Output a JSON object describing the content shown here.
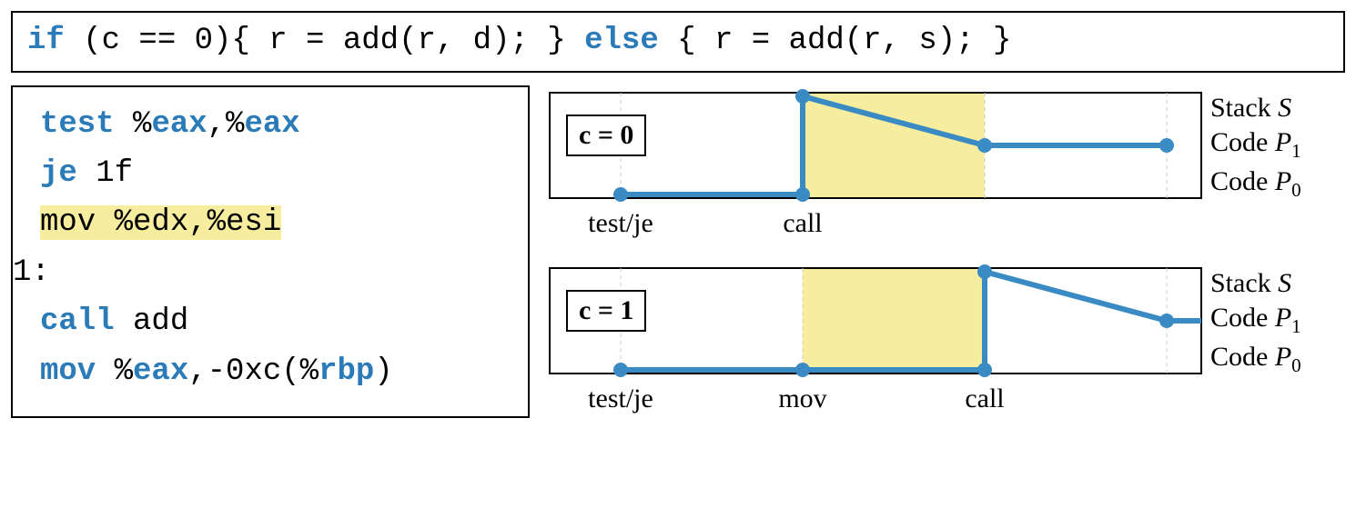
{
  "source_code": {
    "kw_if": "if",
    "cond": " (c == 0){ r = add(r, d); } ",
    "kw_else": "else",
    "else_body": " { r = add(r, s); }"
  },
  "asm": {
    "l1_op": "test",
    "l1_args_a": " %",
    "l1_reg1": "eax",
    "l1_comma": ",%",
    "l1_reg2": "eax",
    "l2_op": "je",
    "l2_arg": " 1f",
    "l3": "mov %edx,%esi",
    "label": "1:",
    "l5_op": "call",
    "l5_arg": " add",
    "l6_op": "mov",
    "l6_sp": " %",
    "l6_reg1": "eax",
    "l6_mid": ",-0xc(%",
    "l6_reg2": "rbp",
    "l6_end": ")"
  },
  "chart0": {
    "cond_label": "c = 0",
    "x1": "test/je",
    "x2": "call",
    "y1": "Stack",
    "y1i": "S",
    "y2": "Code",
    "y2i": "P",
    "y2s": "1",
    "y3": "Code",
    "y3i": "P",
    "y3s": "0"
  },
  "chart1": {
    "cond_label": "c = 1",
    "x1": "test/je",
    "x2": "mov",
    "x3": "call",
    "y1": "Stack",
    "y1i": "S",
    "y2": "Code",
    "y2i": "P",
    "y2s": "1",
    "y3": "Code",
    "y3i": "P",
    "y3s": "0"
  },
  "chart_data": [
    {
      "type": "line",
      "title": "c = 0",
      "x_categories": [
        "test/je",
        "call"
      ],
      "y_categories": [
        "Code P0",
        "Code P1",
        "Stack S"
      ],
      "highlight_region": {
        "x_start": "call",
        "x_end_index": 2
      },
      "points": [
        {
          "x": "test/je",
          "y": "Code P0"
        },
        {
          "x": "call",
          "y": "Code P0"
        },
        {
          "x": "call",
          "y": "Stack S"
        },
        {
          "x_index": 2,
          "y": "Code P1"
        },
        {
          "x_index": 3,
          "y": "Code P1"
        }
      ]
    },
    {
      "type": "line",
      "title": "c = 1",
      "x_categories": [
        "test/je",
        "mov",
        "call"
      ],
      "y_categories": [
        "Code P0",
        "Code P1",
        "Stack S"
      ],
      "highlight_region": {
        "x_start": "mov",
        "x_end": "call"
      },
      "points": [
        {
          "x": "test/je",
          "y": "Code P0"
        },
        {
          "x": "mov",
          "y": "Code P0"
        },
        {
          "x": "call",
          "y": "Code P0"
        },
        {
          "x": "call",
          "y": "Stack S"
        },
        {
          "x_index": 3,
          "y": "Code P1"
        },
        {
          "x_index": 4,
          "y": "Code P1"
        }
      ]
    }
  ]
}
